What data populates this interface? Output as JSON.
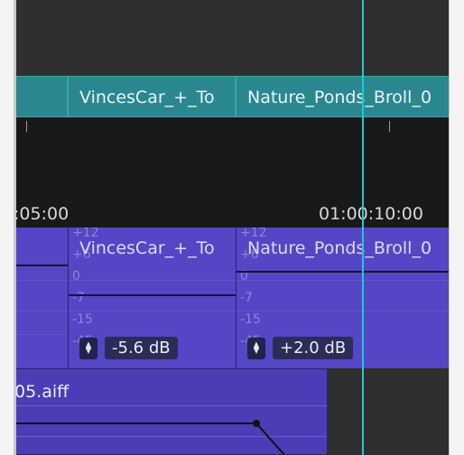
{
  "video_track": {
    "clips": [
      {
        "label": ""
      },
      {
        "label": "VincesCar_+_To"
      },
      {
        "label": "Nature_Ponds_Broll_0"
      }
    ]
  },
  "ruler": {
    "timecodes": [
      ":05:00",
      "01:00:10:00"
    ]
  },
  "audio_track": {
    "clips": [
      {
        "label": "",
        "gain": ""
      },
      {
        "label": "VincesCar_+_To",
        "gain": "-5.6 dB",
        "scale": [
          "+12",
          "+6",
          "0",
          "-7",
          "-15",
          "-45"
        ]
      },
      {
        "label": "Nature_Ponds_Broll_0",
        "gain": "+2.0 dB",
        "scale": [
          "+12",
          "+6",
          "0",
          "-7",
          "-15",
          "-45"
        ]
      }
    ]
  },
  "audio_track2": {
    "clip_label": "05.aiff"
  },
  "colors": {
    "video_clip": "#2a8790",
    "audio_clip": "#5446c4",
    "playhead": "#22c7d6"
  }
}
